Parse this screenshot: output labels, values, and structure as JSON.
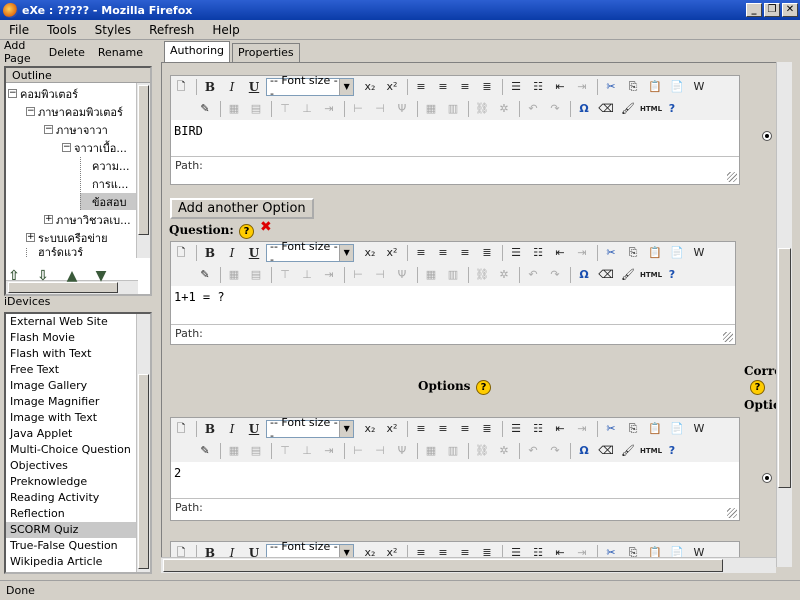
{
  "window": {
    "title": "eXe : ????? - Mozilla Firefox",
    "min": "_",
    "max": "❐",
    "close": "✕"
  },
  "menu": [
    "File",
    "Tools",
    "Styles",
    "Refresh",
    "Help"
  ],
  "actions": {
    "add_page": "Add Page",
    "delete": "Delete",
    "rename": "Rename"
  },
  "outline": {
    "title": "Outline",
    "nodes": [
      {
        "label": "คอมพิวเตอร์",
        "toggle": "−"
      },
      {
        "label": "ภาษาคอมพิวเตอร์",
        "toggle": "−"
      },
      {
        "label": "ภาษาจาวา",
        "toggle": "−"
      },
      {
        "label": "จาวาเบื้อ...",
        "toggle": "−"
      },
      {
        "label": "ความ..."
      },
      {
        "label": "การแ..."
      },
      {
        "label": "ข้อสอบ",
        "selected": true
      },
      {
        "label": "ภาษาวิชวลเบ...",
        "toggle": "+"
      },
      {
        "label": "ระบบเครือข่าย",
        "toggle": "+"
      },
      {
        "label": "ฮาร์ดแวร์"
      }
    ]
  },
  "nav_arrows": [
    "⇧",
    "⇩",
    "▲",
    "▼"
  ],
  "idevices": {
    "label": "iDevices",
    "items": [
      "External Web Site",
      "Flash Movie",
      "Flash with Text",
      "Free Text",
      "Image Gallery",
      "Image Magnifier",
      "Image with Text",
      "Java Applet",
      "Multi-Choice Question",
      "Objectives",
      "Preknowledge",
      "Reading Activity",
      "Reflection",
      "SCORM Quiz",
      "True-False Question",
      "Wikipedia Article"
    ],
    "selected": "SCORM Quiz"
  },
  "tabs": {
    "authoring": "Authoring",
    "properties": "Properties"
  },
  "editor": {
    "font_size_placeholder": "-- Font size --",
    "path_label": "Path:",
    "html_label": "HTML"
  },
  "editors": {
    "option1_text": "BIRD",
    "question_text": "1+1 = ?",
    "option2_text": "2"
  },
  "buttons": {
    "add_option": "Add another Option"
  },
  "labels": {
    "question": "Question:",
    "options": "Options",
    "correct": "Corre",
    "option": "Optio"
  },
  "help_glyph": "?",
  "delete_glyph": "✖",
  "status": "Done"
}
